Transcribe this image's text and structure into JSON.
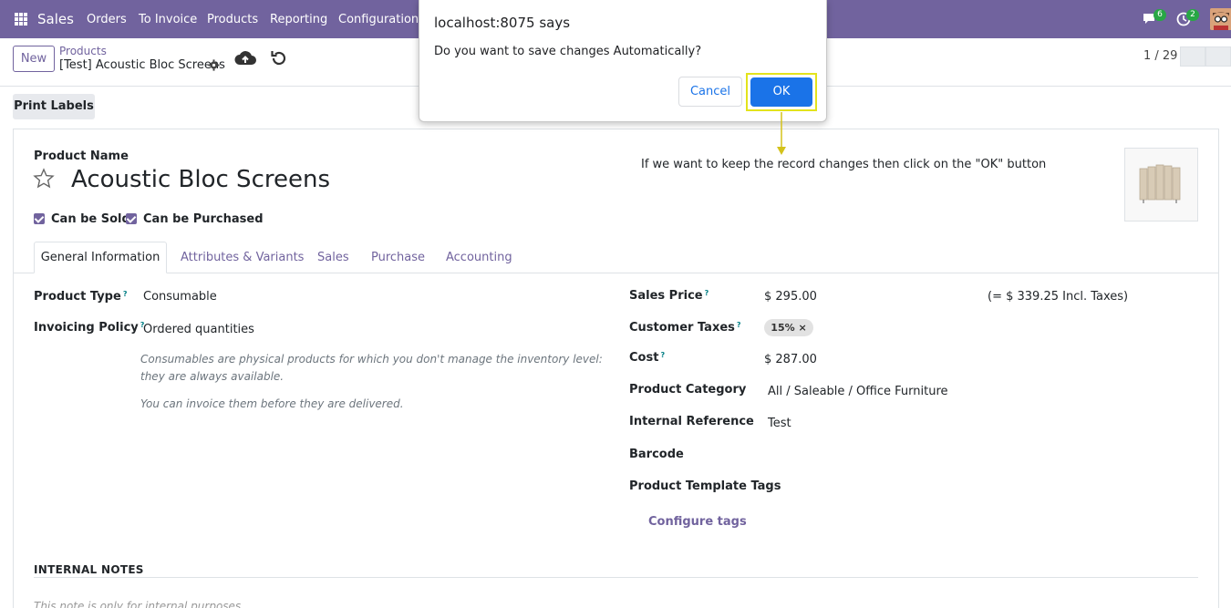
{
  "navbar": {
    "brand": "Sales",
    "menu": [
      "Orders",
      "To Invoice",
      "Products",
      "Reporting",
      "Configuration"
    ],
    "messages_count": "6",
    "activities_count": "2",
    "colors": {
      "bg": "#71639e"
    }
  },
  "control_panel": {
    "new_label": "New",
    "breadcrumb_parent": "Products",
    "breadcrumb_current": "[Test] Acoustic Bloc Screens",
    "pager": "1 / 29"
  },
  "actions": {
    "print_labels": "Print Labels"
  },
  "form": {
    "product_name_label": "Product Name",
    "product_name": "Acoustic Bloc Screens",
    "can_be_sold": "Can be Sold",
    "can_be_purchased": "Can be Purchased",
    "tabs": [
      "General Information",
      "Attributes & Variants",
      "Sales",
      "Purchase",
      "Accounting"
    ],
    "left": {
      "product_type_label": "Product Type",
      "product_type": "Consumable",
      "invoicing_policy_label": "Invoicing Policy",
      "invoicing_policy": "Ordered quantities",
      "help_consumable": "Consumables are physical products for which you don't manage the inventory level: they are always available.",
      "help_invoice": "You can invoice them before they are delivered."
    },
    "right": {
      "sales_price_label": "Sales Price",
      "sales_price": "$ 295.00",
      "incl_taxes": "(= $ 339.25 Incl. Taxes)",
      "customer_taxes_label": "Customer Taxes",
      "tax_tag": "15%",
      "cost_label": "Cost",
      "cost": "$ 287.00",
      "product_category_label": "Product Category",
      "product_category": "All / Saleable / Office Furniture",
      "internal_reference_label": "Internal Reference",
      "internal_reference": "Test",
      "barcode_label": "Barcode",
      "template_tags_label": "Product Template Tags",
      "configure_tags": "Configure tags"
    },
    "internal_notes_title": "INTERNAL NOTES",
    "internal_notes_placeholder": "This note is only for internal purposes."
  },
  "dialog": {
    "title": "localhost:8075 says",
    "message": "Do you want to save changes Automatically?",
    "cancel": "Cancel",
    "ok": "OK"
  },
  "annotation": {
    "text": "If we want to keep the record changes then click on the \"OK\" button"
  }
}
